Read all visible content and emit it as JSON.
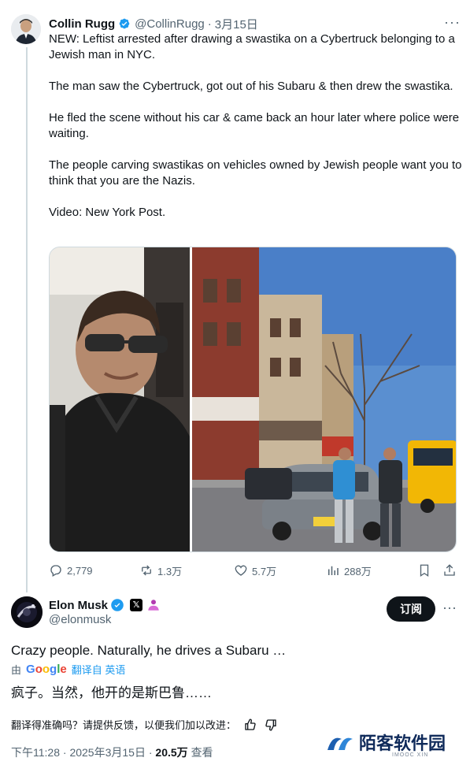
{
  "quoted_tweet": {
    "author_name": "Collin Rugg",
    "author_handle": "@CollinRugg",
    "separator": "·",
    "date": "3月15日",
    "paragraphs": [
      "NEW: Leftist arrested after drawing a swastika on a Cybertruck belonging to a Jewish man in NYC.",
      "The man saw the Cybertruck, got out of his Subaru & then drew the swastika.",
      "He fled the scene without his car & came back an hour later where police were waiting.",
      "The people carving swastikas on vehicles owned by Jewish people want you to think that you are the Nazis.",
      "Video: New York Post."
    ],
    "actions": {
      "replies": "2,779",
      "reposts": "1.3万",
      "likes": "5.7万",
      "views": "288万"
    }
  },
  "main_tweet": {
    "author_name": "Elon Musk",
    "author_handle": "@elonmusk",
    "x_badge": "𝕏",
    "subscribe_label": "订阅",
    "text": "Crazy people. Naturally, he drives a Subaru …",
    "translate_prefix": "由",
    "translate_provider": "Google",
    "translate_link": "翻译自 英语",
    "translated_text": "疯子。当然，他开的是斯巴鲁……",
    "feedback_prompt": "翻译得准确吗？请提供反馈，以便我们加以改进：",
    "time": "下午11:28",
    "meta_separator": "·",
    "date": "2025年3月15日",
    "views_count": "20.5万",
    "views_label": "查看"
  },
  "watermark": {
    "text": "陌客软件园",
    "sub": "IMOOC XIN"
  },
  "colors": {
    "verified": "#1d9bf0",
    "link": "#1d9bf0",
    "muted": "#536471",
    "subscribe_bg": "#0f1419"
  }
}
